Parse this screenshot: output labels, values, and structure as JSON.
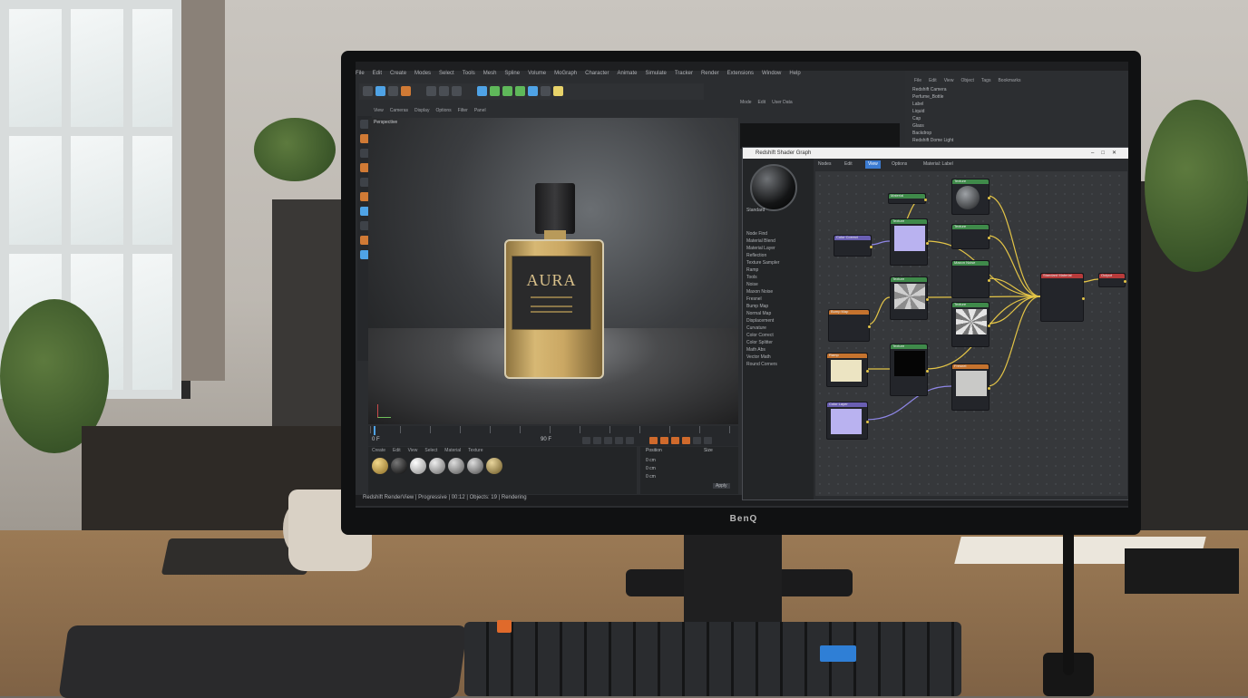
{
  "scene": {
    "monitor_brand": "BenQ",
    "product_text": "AURA"
  },
  "app": {
    "menu": [
      "File",
      "Edit",
      "Create",
      "Modes",
      "Select",
      "Tools",
      "Mesh",
      "Spline",
      "Volume",
      "MoGraph",
      "Character",
      "Animate",
      "Simulate",
      "Tracker",
      "Render",
      "Extensions",
      "Window",
      "Help"
    ],
    "viewport_menu": [
      "View",
      "Cameras",
      "Display",
      "Options",
      "Filter",
      "Panel"
    ],
    "viewport_label": "Perspective",
    "timeline": {
      "start_frame": "0 F",
      "end_frame": "90 F"
    },
    "material_menu": [
      "Create",
      "Edit",
      "View",
      "Select",
      "Material",
      "Texture"
    ],
    "coordinates": {
      "title": "Position",
      "title2": "Size",
      "x": "0 cm",
      "y": "0 cm",
      "z": "0 cm",
      "apply": "Apply"
    },
    "statusbar": "Redshift RenderView | Progressive | 00:12 | Objects: 19 | Rendering",
    "attribute_menu": [
      "Mode",
      "Edit",
      "User Data"
    ],
    "object_manager_menu": [
      "File",
      "Edit",
      "View",
      "Object",
      "Tags",
      "Bookmarks"
    ],
    "objects": [
      "Redshift Camera",
      "Perfume_Bottle",
      "Label",
      "Liquid",
      "Cap",
      "Glass",
      "Backdrop",
      "Redshift Dome Light"
    ]
  },
  "node_editor": {
    "title": "Redshift Shader Graph",
    "tabs": [
      "Nodes",
      "Edit",
      "View",
      "Options",
      "Material: Label"
    ],
    "active_tab": "View",
    "preview_caption": "Standard",
    "sidebar_items": [
      "Node Find",
      "Material Blend",
      "Material Layer",
      "Reflection",
      "Texture Sampler",
      "Ramp",
      "Tools",
      "Noise",
      "Maxon Noise",
      "Fresnel",
      "Bump Map",
      "Normal Map",
      "Displacement",
      "Curvature",
      "Color Correct",
      "Color Splitter",
      "Math Abs",
      "Vector Math",
      "Round Corners"
    ],
    "nodes": [
      {
        "name": "Texture",
        "color": "#3f8a4a"
      },
      {
        "name": "Color Correct",
        "color": "#6a5fb3"
      },
      {
        "name": "Texture",
        "color": "#3f8a4a"
      },
      {
        "name": "Material",
        "color": "#3f8a4a"
      },
      {
        "name": "Texture",
        "color": "#3f8a4a"
      },
      {
        "name": "Maxon Noise",
        "color": "#3f8a4a"
      },
      {
        "name": "Bump Map",
        "color": "#c5732e"
      },
      {
        "name": "Texture",
        "color": "#3f8a4a"
      },
      {
        "name": "Texture",
        "color": "#3f8a4a"
      },
      {
        "name": "Ramp",
        "color": "#c5732e"
      },
      {
        "name": "Texture",
        "color": "#3f8a4a"
      },
      {
        "name": "Fresnel",
        "color": "#c5732e"
      },
      {
        "name": "Color Layer",
        "color": "#6a5fb3"
      },
      {
        "name": "Standard Material",
        "color": "#b83b3b"
      },
      {
        "name": "Output",
        "color": "#b83b3b"
      }
    ]
  }
}
